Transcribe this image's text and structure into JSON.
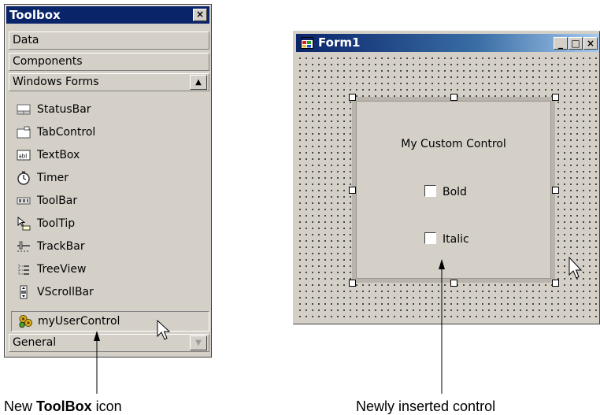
{
  "toolbox": {
    "title": "Toolbox",
    "close_glyph": "×",
    "sections": {
      "data": "Data",
      "components": "Components",
      "windows_forms": "Windows Forms",
      "general": "General"
    },
    "items": [
      {
        "label": "StatusBar",
        "icon": "statusbar-icon"
      },
      {
        "label": "TabControl",
        "icon": "tabcontrol-icon"
      },
      {
        "label": "TextBox",
        "icon": "textbox-icon"
      },
      {
        "label": "Timer",
        "icon": "timer-icon"
      },
      {
        "label": "ToolBar",
        "icon": "toolbar-icon"
      },
      {
        "label": "ToolTip",
        "icon": "tooltip-icon"
      },
      {
        "label": "TrackBar",
        "icon": "trackbar-icon"
      },
      {
        "label": "TreeView",
        "icon": "treeview-icon"
      },
      {
        "label": "VScrollBar",
        "icon": "vscrollbar-icon"
      }
    ],
    "user_item": {
      "label": "myUserControl",
      "icon": "user-control-icon"
    }
  },
  "form": {
    "title": "Form1",
    "buttons": {
      "minimize": "_",
      "maximize": "□",
      "close": "×"
    },
    "user_control": {
      "label": "My Custom Control",
      "checkboxes": [
        {
          "label": "Bold",
          "checked": false
        },
        {
          "label": "Italic",
          "checked": false
        }
      ]
    }
  },
  "annotations": {
    "toolbox_caption_prefix": "New ",
    "toolbox_caption_bold": "ToolBox",
    "toolbox_caption_suffix": " icon",
    "control_caption": "Newly inserted control"
  }
}
